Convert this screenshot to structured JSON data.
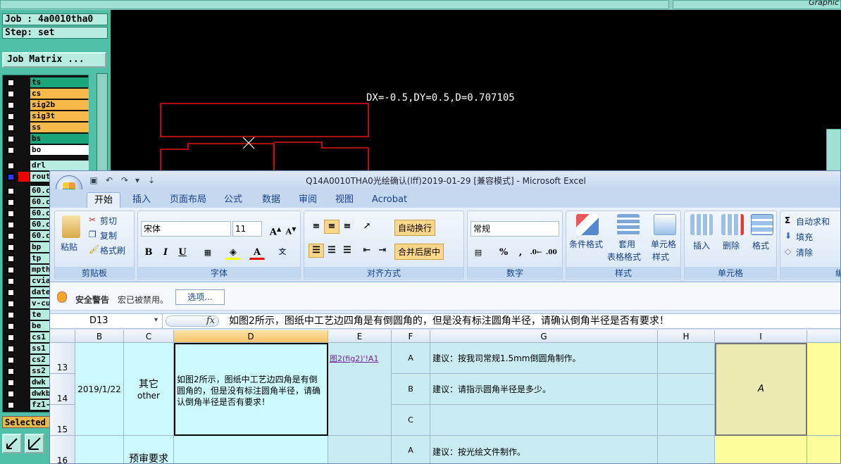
{
  "cam": {
    "graphic_label": "Graphic",
    "job": "Job : 4a0010tha0",
    "step": "Step: set",
    "job_matrix": "Job Matrix ...",
    "measure": "DX=-0.5,DY=0.5,D=0.707105",
    "selected": "Selected",
    "layers": [
      {
        "name": "ts",
        "color": "#1aa67a",
        "selected": false
      },
      {
        "name": "cs",
        "color": "#f6b94a",
        "selected": false
      },
      {
        "name": "sig2b",
        "color": "#f6b94a",
        "selected": false
      },
      {
        "name": "sig3t",
        "color": "#f6b94a",
        "selected": false
      },
      {
        "name": "ss",
        "color": "#f6b94a",
        "selected": false
      },
      {
        "name": "bs",
        "color": "#1aa67a",
        "selected": false
      },
      {
        "name": "bo",
        "color": "#ffffff",
        "selected": false
      },
      {
        "name": "drl",
        "color": "#b8ece0",
        "selected": false
      },
      {
        "name": "rout",
        "color": "#b8ece0",
        "selected": true
      },
      {
        "name": "60.c",
        "color": "#b8ece0",
        "selected": false
      },
      {
        "name": "60.c",
        "color": "#b8ece0",
        "selected": false
      },
      {
        "name": "60.c",
        "color": "#b8ece0",
        "selected": false
      },
      {
        "name": "60.c",
        "color": "#b8ece0",
        "selected": false
      },
      {
        "name": "60.c",
        "color": "#b8ece0",
        "selected": false
      },
      {
        "name": "bp",
        "color": "#b8ece0",
        "selected": false
      },
      {
        "name": "tp",
        "color": "#b8ece0",
        "selected": false
      },
      {
        "name": "mpth",
        "color": "#b8ece0",
        "selected": false
      },
      {
        "name": "cvia",
        "color": "#b8ece0",
        "selected": false
      },
      {
        "name": "date",
        "color": "#b8ece0",
        "selected": false
      },
      {
        "name": "v-cu",
        "color": "#b8ece0",
        "selected": false
      },
      {
        "name": "te",
        "color": "#b8ece0",
        "selected": false
      },
      {
        "name": "be",
        "color": "#b8ece0",
        "selected": false
      },
      {
        "name": "cs1",
        "color": "#b8ece0",
        "selected": false
      },
      {
        "name": "ss1",
        "color": "#b8ece0",
        "selected": false
      },
      {
        "name": "cs2",
        "color": "#b8ece0",
        "selected": false
      },
      {
        "name": "ss2",
        "color": "#b8ece0",
        "selected": false
      },
      {
        "name": "dwk",
        "color": "#b8ece0",
        "selected": false
      },
      {
        "name": "dwkb",
        "color": "#b8ece0",
        "selected": false
      },
      {
        "name": "fz1-",
        "color": "#b8ece0",
        "selected": false
      }
    ]
  },
  "excel": {
    "title": "Q14A0010THA0光绘确认(lff)2019-01-29  [兼容模式] - Microsoft Excel",
    "tabs": [
      "开始",
      "插入",
      "页面布局",
      "公式",
      "数据",
      "审阅",
      "视图",
      "Acrobat"
    ],
    "active_tab": "开始",
    "clipboard": {
      "paste": "粘贴",
      "cut": "剪切",
      "copy": "复制",
      "format_painter": "格式刷",
      "label": "剪贴板"
    },
    "font": {
      "name": "宋体",
      "size": "11",
      "label": "字体",
      "bold": "B",
      "italic": "I",
      "underline": "U"
    },
    "alignment": {
      "wrap": "自动换行",
      "merge": "合并后居中",
      "label": "对齐方式"
    },
    "number": {
      "format": "常规",
      "percent": "%",
      "comma": ",",
      "label": "数字"
    },
    "styles": {
      "conditional": "条件格式",
      "table_format_1": "套用",
      "table_format_2": "表格格式",
      "cell_style_1": "单元格",
      "cell_style_2": "样式",
      "label": "样式"
    },
    "cells": {
      "insert": "插入",
      "delete": "删除",
      "format": "格式",
      "label": "单元格"
    },
    "editing": {
      "autosum": "自动求和",
      "fill": "填充",
      "clear": "清除",
      "label": "编"
    },
    "security": {
      "title": "安全警告",
      "message": "宏已被禁用。",
      "options_button": "选项..."
    },
    "name_box": "D13",
    "fx": "fx",
    "formula": "如图2所示，图纸中工艺边四角是有倒圆角的，但是没有标注圆角半径，请确认倒角半径是否有要求！",
    "columns": [
      "B",
      "C",
      "D",
      "E",
      "F",
      "G",
      "H",
      "I"
    ],
    "rows": {
      "r13": "13",
      "r14": "14",
      "r15": "15",
      "r16": "16",
      "date": "2019/1/22",
      "category_cn": "其它",
      "category_en": "other",
      "question": "如图2所示，图纸中工艺边四角是有倒圆角的，但是没有标注圆角半径，请确认倒角半径是否有要求！",
      "link": "图2(fig2)'!A1",
      "option_a": "A",
      "option_b": "B",
      "option_c": "C",
      "suggest_a": "建议：按我司常规1.5mm倒圆角制作。",
      "suggest_b": "建议：请指示圆角半径是多少。",
      "answer": "A",
      "r16_category": "预审要求",
      "r16_option": "A",
      "r16_suggest": "建议：按光绘文件制作。"
    }
  }
}
